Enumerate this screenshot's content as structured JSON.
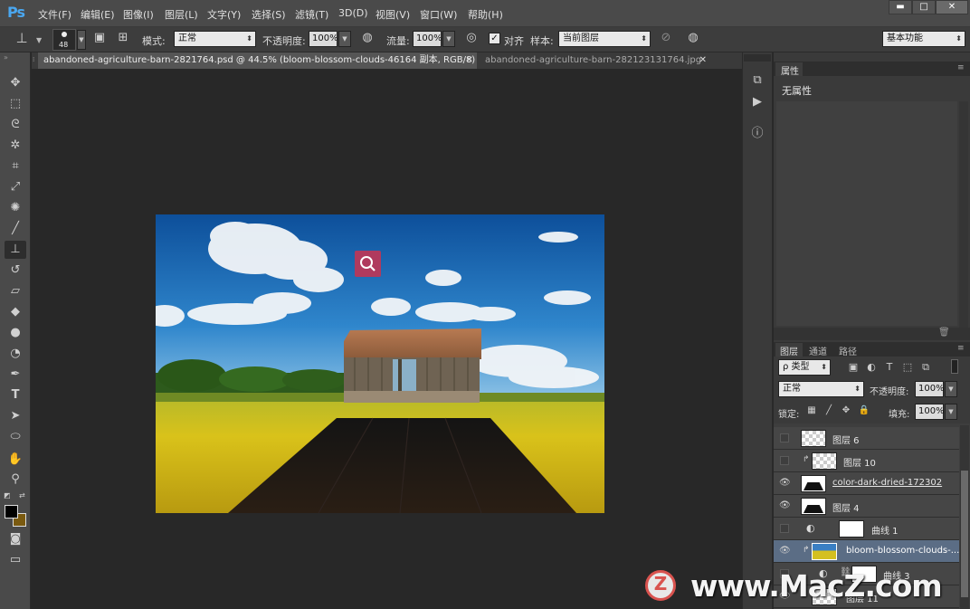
{
  "app": {
    "logo": "Ps"
  },
  "menu": [
    "文件(F)",
    "编辑(E)",
    "图像(I)",
    "图层(L)",
    "文字(Y)",
    "选择(S)",
    "滤镜(T)",
    "3D(D)",
    "视图(V)",
    "窗口(W)",
    "帮助(H)"
  ],
  "window_controls": {
    "minimize": "▬",
    "maximize": "□",
    "close": "✕"
  },
  "options": {
    "brush_size": "48",
    "mode_label": "模式:",
    "mode_value": "正常",
    "opacity_label": "不透明度:",
    "opacity_value": "100%",
    "flow_label": "流量:",
    "flow_value": "100%",
    "align_label": "对齐",
    "sample_label": "样本:",
    "sample_value": "当前图层",
    "workspace": "基本功能"
  },
  "tabs": [
    {
      "label": "abandoned-agriculture-barn-2821764.psd @ 44.5% (bloom-blossom-clouds-46164 副本, RGB/8) *",
      "close": "✕"
    },
    {
      "label": "abandoned-agriculture-barn-282123131764.jpg",
      "close": "✕"
    }
  ],
  "properties_panel": {
    "tab": "属性",
    "content": "无属性"
  },
  "layers_panel": {
    "tabs": [
      "图层",
      "通道",
      "路径"
    ],
    "filter_label": "ρ 类型",
    "blend_mode": "正常",
    "opacity_label": "不透明度:",
    "opacity_value": "100%",
    "lock_label": "锁定:",
    "fill_label": "填充:",
    "fill_value": "100%",
    "layers": [
      {
        "name": "图层 6",
        "visible": false
      },
      {
        "name": "图层 10",
        "visible": false
      },
      {
        "name": "color-dark-dried-172302",
        "visible": true
      },
      {
        "name": "图层 4",
        "visible": true
      },
      {
        "name": "曲线 1",
        "visible": false
      },
      {
        "name": "bloom-blossom-clouds-...",
        "visible": true,
        "selected": true
      },
      {
        "name": "曲线 3",
        "visible": false
      },
      {
        "name": "图层 11",
        "visible": true
      }
    ]
  },
  "watermark": {
    "logo_letter": "Z",
    "text": "www.MacZ.com"
  },
  "colors": {
    "foreground": "#000000",
    "background": "#7a5a10",
    "accent": "#4aa7f0",
    "selection": "#5b6d85"
  }
}
